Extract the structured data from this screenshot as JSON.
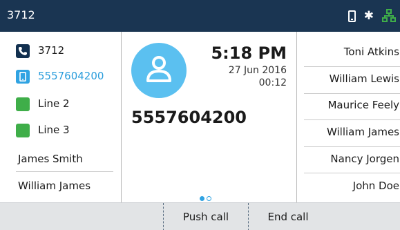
{
  "status_bar": {
    "extension": "3712",
    "icons": [
      "mobile-phone-icon",
      "bluetooth-icon",
      "network-icon"
    ],
    "network_color": "#3fae49"
  },
  "lines": [
    {
      "label": "3712",
      "icon": "phone-handset-icon",
      "color": "#12304f"
    },
    {
      "label": "5557604200",
      "icon": "mobile-phone-icon",
      "color": "#30a3e2"
    },
    {
      "label": "Line 2",
      "icon": "line-indicator",
      "color": "#3fae49"
    },
    {
      "label": "Line 3",
      "icon": "line-indicator",
      "color": "#3fae49"
    }
  ],
  "left_contacts": [
    "James Smith",
    "William James"
  ],
  "call": {
    "time": "5:18 PM",
    "date": "27 Jun 2016",
    "duration": "00:12",
    "number": "5557604200",
    "accent": "#5bc0f0"
  },
  "right_contacts": [
    "Toni Atkins",
    "William Lewis",
    "Maurice Feely",
    "William James",
    "Nancy Jorgen",
    "John Doe"
  ],
  "softkeys": {
    "push_call": "Push call",
    "end_call": "End call"
  }
}
